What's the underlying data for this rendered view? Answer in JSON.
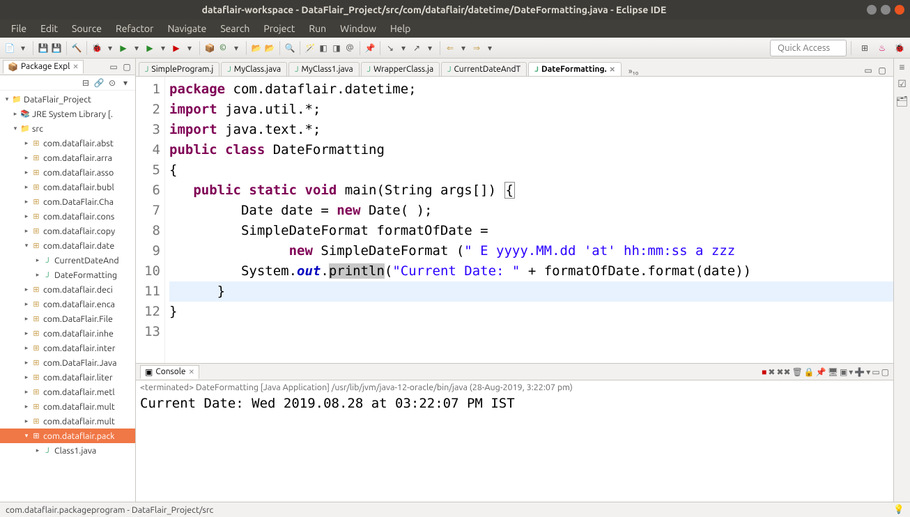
{
  "window": {
    "title": "dataflair-workspace - DataFlair_Project/src/com/dataflair/datetime/DateFormatting.java - Eclipse IDE"
  },
  "menubar": [
    "File",
    "Edit",
    "Source",
    "Refactor",
    "Navigate",
    "Search",
    "Project",
    "Run",
    "Window",
    "Help"
  ],
  "quickaccess": "Quick Access",
  "package_explorer": {
    "title": "Package Expl",
    "project": "DataFlair_Project",
    "jre": "JRE System Library [.",
    "src": "src",
    "packages": [
      "com.dataflair.abst",
      "com.dataflair.arra",
      "com.dataflair.asso",
      "com.dataflair.bubl",
      "com.DataFlair.Cha",
      "com.dataflair.cons",
      "com.dataflair.copy"
    ],
    "open_pkg": "com.dataflair.date",
    "open_files": [
      "CurrentDateAnd",
      "DateFormatting"
    ],
    "packages2": [
      "com.dataflair.deci",
      "com.dataflair.enca",
      "com.DataFlair.File",
      "com.dataflair.inhe",
      "com.dataflair.inter",
      "com.DataFlair.Java",
      "com.dataflair.liter",
      "com.dataflair.metl",
      "com.dataflair.mult",
      "com.dataflair.mult"
    ],
    "selected_pkg": "com.dataflair.pack",
    "selected_file": "Class1.java"
  },
  "editor_tabs": [
    {
      "label": "SimpleProgram.j",
      "active": false
    },
    {
      "label": "MyClass.java",
      "active": false
    },
    {
      "label": "MyClass1.java",
      "active": false
    },
    {
      "label": "WrapperClass.ja",
      "active": false
    },
    {
      "label": "CurrentDateAndT",
      "active": false
    },
    {
      "label": "DateFormatting.",
      "active": true
    }
  ],
  "tab_overflow": "»₁₀",
  "code": {
    "l1a": "package",
    "l1b": " com.dataflair.datetime;",
    "l2a": "import",
    "l2b": " java.util.*;",
    "l3a": "import",
    "l3b": " java.text.*;",
    "l4a": "public",
    "l4b": "class",
    "l4c": " DateFormatting",
    "l5": "{",
    "l6a": "public",
    "l6b": "static",
    "l6c": "void",
    "l6d": " main(String args[]) ",
    "l7a": "         Date date = ",
    "l7b": "new",
    "l7c": " Date( );",
    "l8": "         SimpleDateFormat formatOfDate =",
    "l9a": "               ",
    "l9b": "new",
    "l9c": " SimpleDateFormat (",
    "l9d": "\" E yyyy.MM.dd 'at' hh:mm:ss a zzz",
    "l10a": "         System.",
    "l10b": "out",
    "l10c": ".",
    "l10d": "println",
    "l10e": "(",
    "l10f": "\"Current Date: \"",
    "l10g": " + formatOfDate.format(date))",
    "l11": "      }",
    "l12": "}",
    "l13": ""
  },
  "line_numbers": [
    "1",
    "2",
    "3",
    "4",
    "5",
    "6",
    "7",
    "8",
    "9",
    "10",
    "11",
    "12",
    "13"
  ],
  "console": {
    "title": "Console",
    "status": "<terminated> DateFormatting [Java Application] /usr/lib/jvm/java-12-oracle/bin/java (28-Aug-2019, 3:22:07 pm)",
    "output": "Current Date:  Wed 2019.08.28 at 03:22:07 PM IST"
  },
  "statusbar": "com.dataflair.packageprogram - DataFlair_Project/src"
}
